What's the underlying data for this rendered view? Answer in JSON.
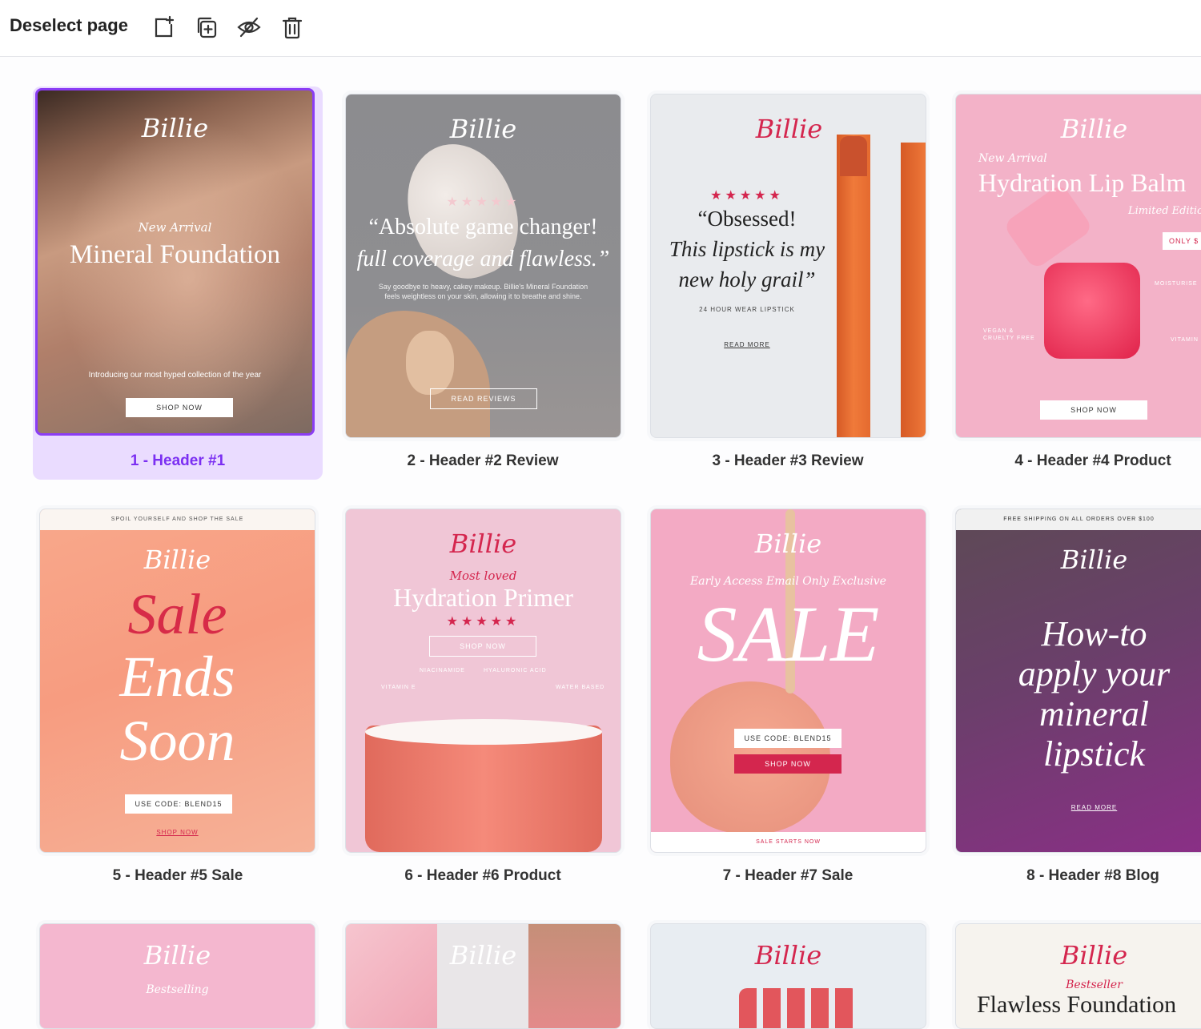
{
  "toolbar": {
    "deselect_label": "Deselect page",
    "icons": [
      "add-page-icon",
      "duplicate-page-icon",
      "hide-page-icon",
      "delete-page-icon"
    ]
  },
  "colors": {
    "accent": "#8b3df5",
    "brand_pink": "#d4264e",
    "selected_bg": "#eadcff"
  },
  "pages": [
    {
      "caption": "1 - Header #1",
      "logo": "Billie",
      "kicker": "New Arrival",
      "title": "Mineral Foundation",
      "body": "Introducing our most hyped collection of the year",
      "cta": "SHOP NOW"
    },
    {
      "caption": "2 - Header #2 Review",
      "logo": "Billie",
      "stars": "★★★★★",
      "quote_line1": "“Absolute game changer!",
      "quote_line2": "full coverage and flawless.”",
      "body": "Say goodbye to heavy, cakey makeup. Billie's Mineral Foundation feels weightless on your skin, allowing it to breathe and shine.",
      "cta": "READ REVIEWS"
    },
    {
      "caption": "3 - Header #3 Review",
      "logo": "Billie",
      "stars": "★★★★★",
      "quote_line1": "“Obsessed!",
      "quote_line2": "This lipstick is my",
      "quote_line3": "new holy grail”",
      "sub": "24 HOUR WEAR LIPSTICK",
      "cta": "READ MORE"
    },
    {
      "caption": "4 - Header #4 Product",
      "logo": "Billie",
      "kicker": "New Arrival",
      "title": "Hydration Lip Balm",
      "edition": "Limited Edition",
      "badge": "ONLY $",
      "feature1": "MOISTURISE",
      "feature2": "VEGAN & CRUELTY FREE",
      "feature3": "VITAMIN",
      "cta": "SHOP NOW"
    },
    {
      "caption": "5 - Header #5 Sale",
      "banner": "SPOIL YOURSELF AND SHOP THE SALE",
      "logo": "Billie",
      "word1": "Sale",
      "word2": "Ends",
      "word3": "Soon",
      "code": "USE CODE: BLEND15",
      "cta": "SHOP NOW"
    },
    {
      "caption": "6 - Header #6 Product",
      "logo": "Billie",
      "kicker": "Most loved",
      "title": "Hydration Primer",
      "stars": "★★★★★",
      "cta": "SHOP NOW",
      "label1": "NIACINAMIDE",
      "label2": "HYALURONIC ACID",
      "label3": "VITAMIN E",
      "label4": "WATER BASED"
    },
    {
      "caption": "7 - Header #7 Sale",
      "logo": "Billie",
      "kicker": "Early Access Email Only Exclusive",
      "title": "SALE",
      "code": "USE CODE: BLEND15",
      "cta": "SHOP NOW",
      "footer": "SALE STARTS NOW"
    },
    {
      "caption": "8 - Header #8 Blog",
      "banner": "FREE SHIPPING ON ALL ORDERS OVER $100",
      "logo": "Billie",
      "line1": "How-to",
      "line2": "apply your",
      "line3": "mineral",
      "line4": "lipstick",
      "cta": "READ MORE"
    },
    {
      "logo": "Billie",
      "kicker": "Bestselling"
    },
    {
      "logo": "Billie"
    },
    {
      "logo": "Billie"
    },
    {
      "logo": "Billie",
      "kicker": "Bestseller",
      "title": "Flawless Foundation"
    }
  ]
}
